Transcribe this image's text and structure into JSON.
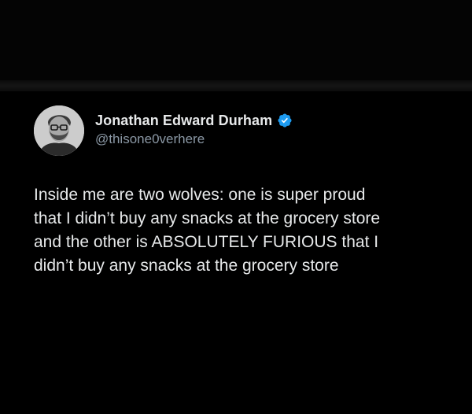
{
  "tweet": {
    "author": {
      "display_name": "Jonathan Edward Durham",
      "handle": "@thisone0verhere",
      "verified": true,
      "verified_icon": "verified-badge-icon",
      "verified_color": "#1d9bf0"
    },
    "text": "Inside me are two wolves: one is super proud\nthat I didn’t buy any snacks at the grocery store\nand the other is ABSOLUTELY FURIOUS that I\ndidn’t buy any snacks at the grocery store"
  },
  "colors": {
    "background": "#000000",
    "text_primary": "#e7e9ea",
    "text_secondary": "#8b98a5"
  }
}
